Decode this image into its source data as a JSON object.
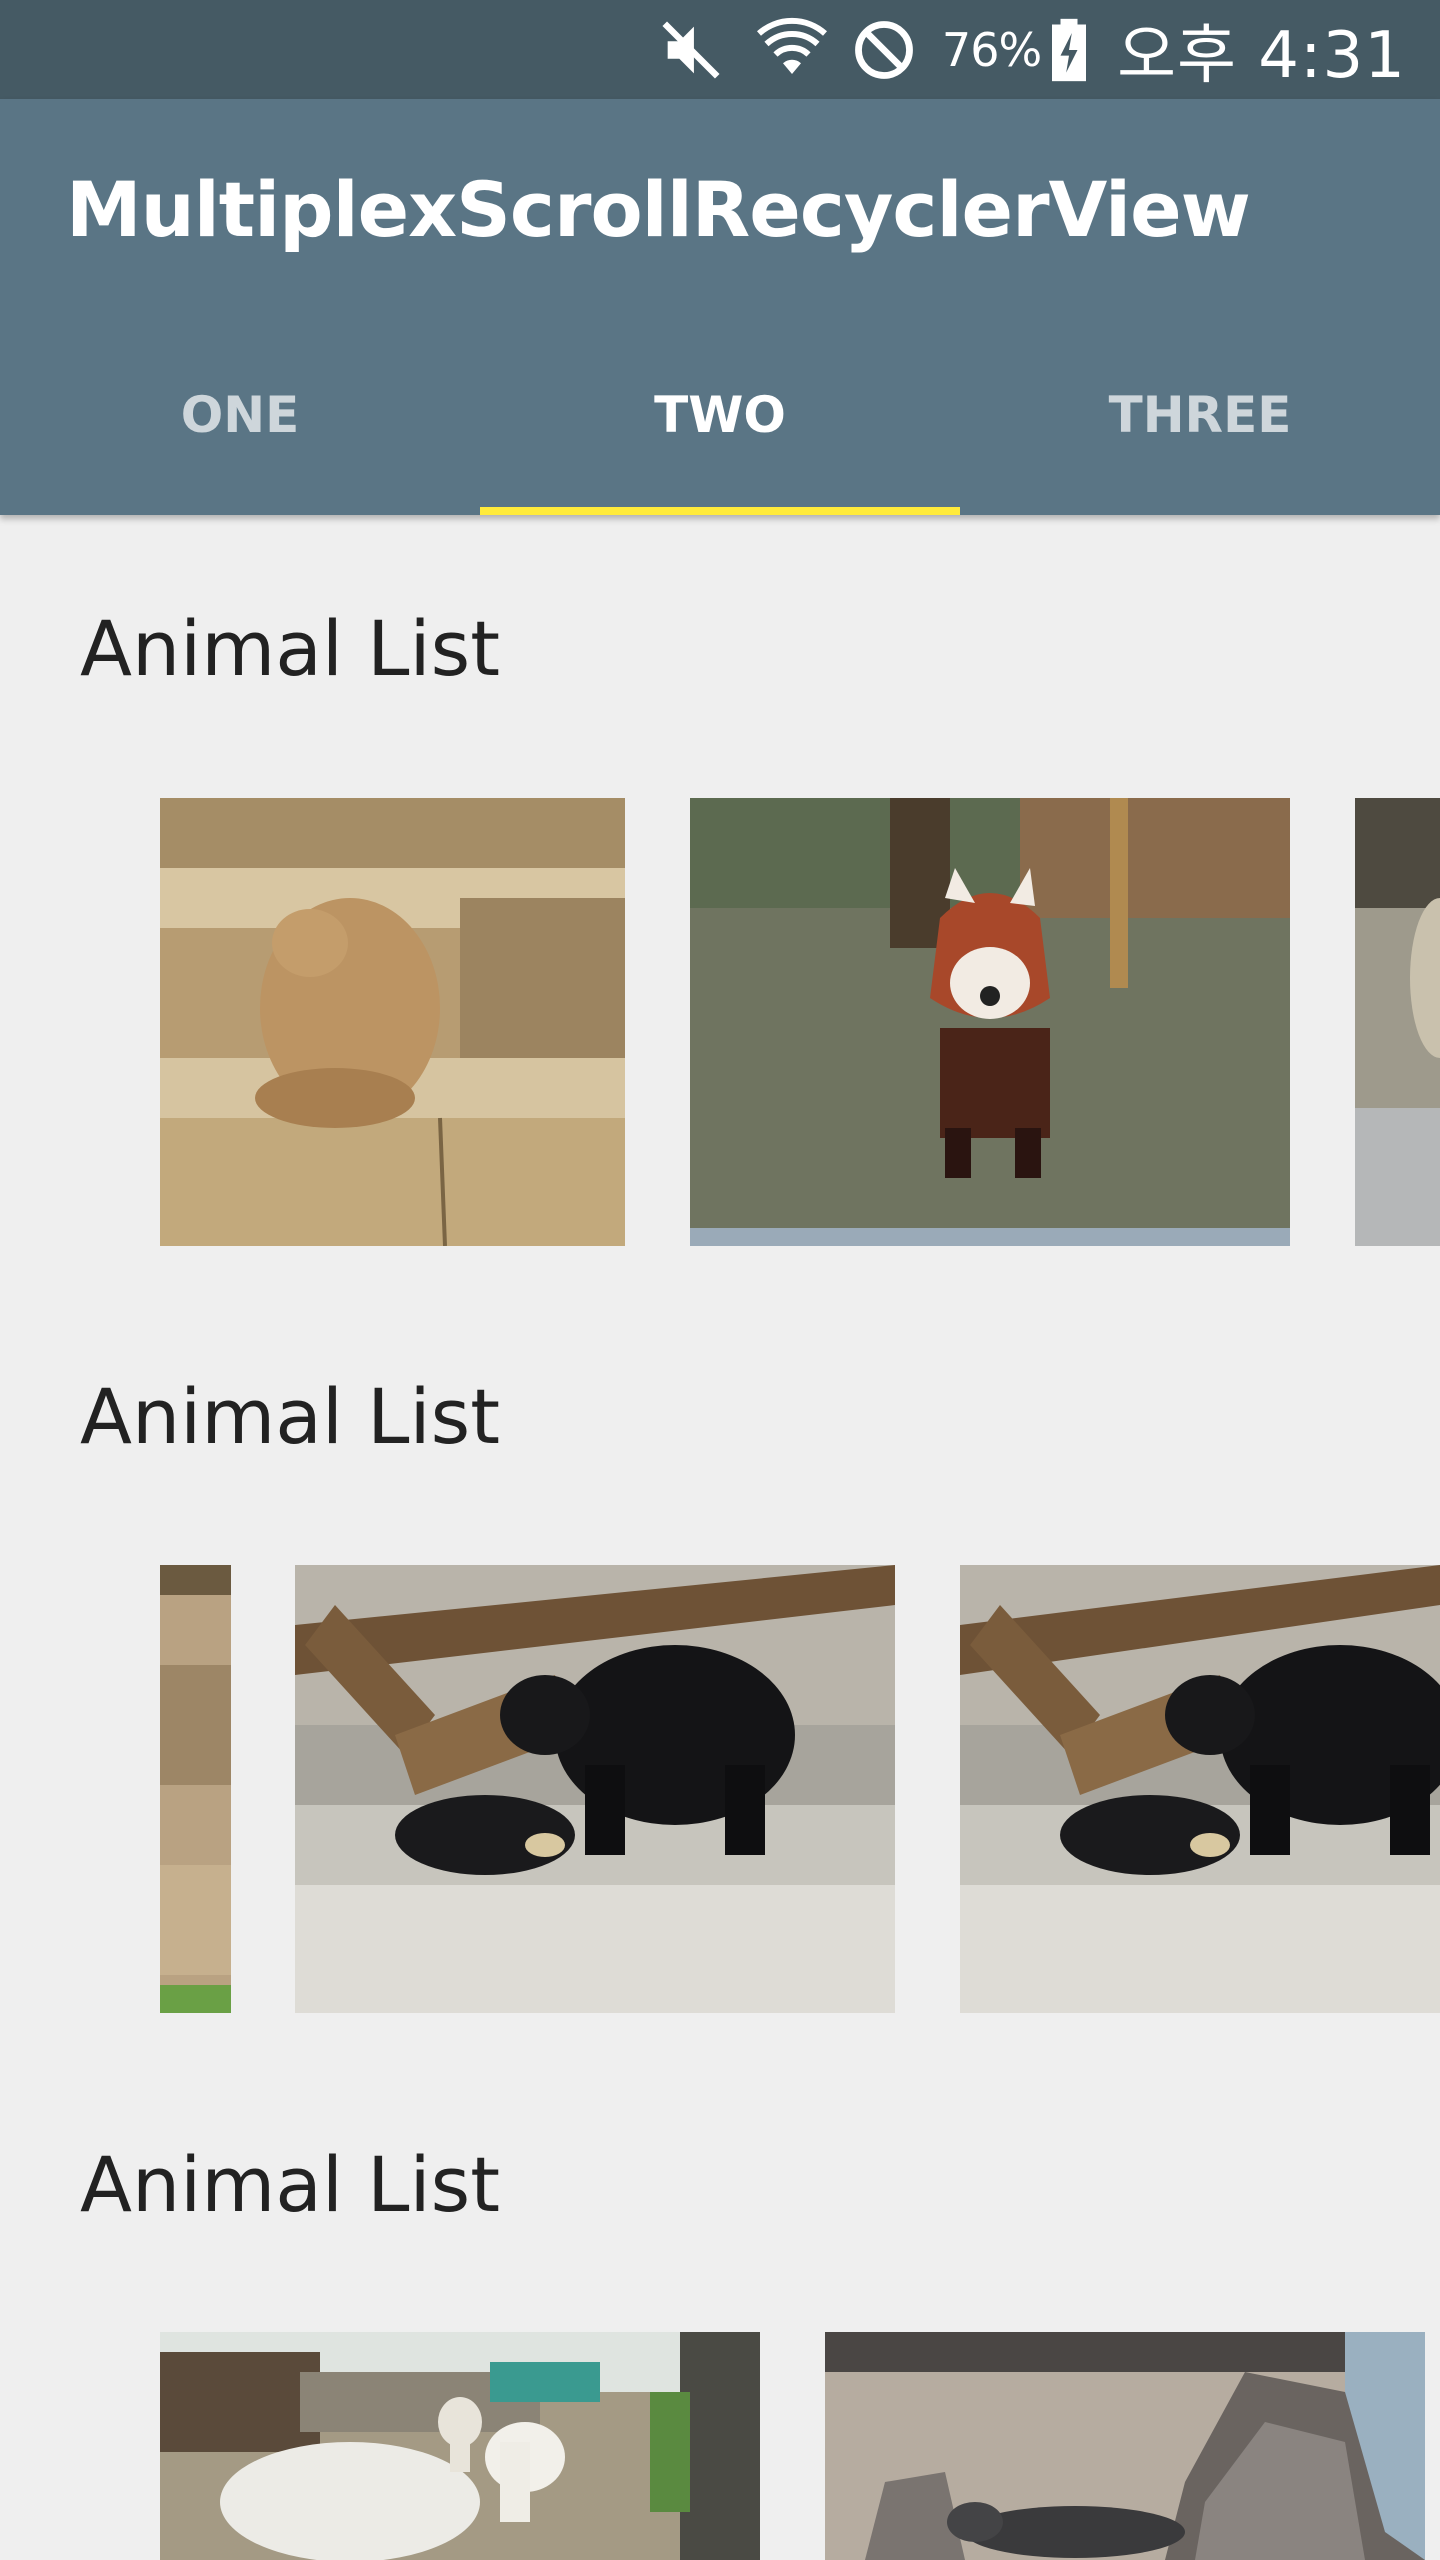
{
  "status_bar": {
    "battery_percent": "76%",
    "time": "오후 4:31",
    "icons": [
      "mute-icon",
      "wifi-icon",
      "do-not-disturb-icon",
      "battery-charging-icon"
    ]
  },
  "app_bar": {
    "title": "MultiplexScrollRecyclerView",
    "tabs": [
      {
        "label": "ONE",
        "selected": false
      },
      {
        "label": "TWO",
        "selected": true
      },
      {
        "label": "THREE",
        "selected": false
      }
    ],
    "indicator_color": "#ffeb3b",
    "background_color": "#5a7585"
  },
  "sections": [
    {
      "title": "Animal List",
      "images": [
        "brown-bear-photo",
        "red-panda-photo",
        "partial-animal-photo"
      ]
    },
    {
      "title": "Animal List",
      "images": [
        "partial-rock-photo",
        "black-bears-photo",
        "black-bears-photo"
      ]
    },
    {
      "title": "Animal List",
      "images": [
        "llamas-photo",
        "seals-photo"
      ]
    }
  ]
}
